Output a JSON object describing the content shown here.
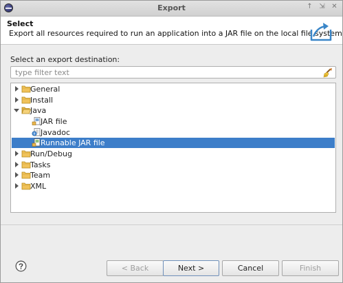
{
  "window": {
    "title": "Export"
  },
  "header": {
    "title": "Select",
    "description": "Export all resources required to run an application into a JAR file on the local file system."
  },
  "section_label": "Select an export destination:",
  "filter": {
    "value": "",
    "placeholder": "type filter text"
  },
  "tree": {
    "items": [
      {
        "label": "General",
        "icon": "folder-icon",
        "expanded": false
      },
      {
        "label": "Install",
        "icon": "folder-icon",
        "expanded": false
      },
      {
        "label": "Java",
        "icon": "folder-open-icon",
        "expanded": true
      },
      {
        "label": "JAR file",
        "icon": "jar-file-icon"
      },
      {
        "label": "Javadoc",
        "icon": "javadoc-icon"
      },
      {
        "label": "Runnable JAR file",
        "icon": "runnable-jar-icon",
        "selected": true
      },
      {
        "label": "Run/Debug",
        "icon": "folder-icon",
        "expanded": false
      },
      {
        "label": "Tasks",
        "icon": "folder-icon",
        "expanded": false
      },
      {
        "label": "Team",
        "icon": "folder-icon",
        "expanded": false
      },
      {
        "label": "XML",
        "icon": "folder-icon",
        "expanded": false
      }
    ]
  },
  "buttons": {
    "back": "< Back",
    "next": "Next >",
    "cancel": "Cancel",
    "finish": "Finish"
  },
  "colors": {
    "selection": "#3d7ec9",
    "folder": "#f0c25a"
  }
}
